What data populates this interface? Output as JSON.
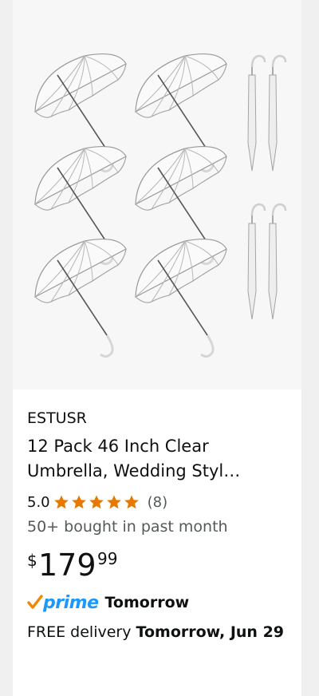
{
  "product": {
    "brand": "ESTUSR",
    "title_line1": "12 Pack 46 Inch Clear",
    "title_line2": "Umbrella, Wedding Styl…",
    "rating_value": "5.0",
    "rating_stars": 5,
    "review_count": "(8)",
    "bought_text": "50+ bought in past month",
    "price": {
      "symbol": "$",
      "whole": "179",
      "fraction": "99"
    },
    "prime": {
      "label": "prime",
      "speed": "Tomorrow"
    },
    "delivery": {
      "prefix": "FREE delivery ",
      "date": "Tomorrow, Jun 29"
    }
  },
  "colors": {
    "star": "#e67a00",
    "prime_blue": "#1a98ff",
    "prime_check": "#f08804",
    "secondary_text": "#565959"
  },
  "icons": [
    "product-image-umbrellas",
    "star-icon",
    "prime-check-icon"
  ]
}
